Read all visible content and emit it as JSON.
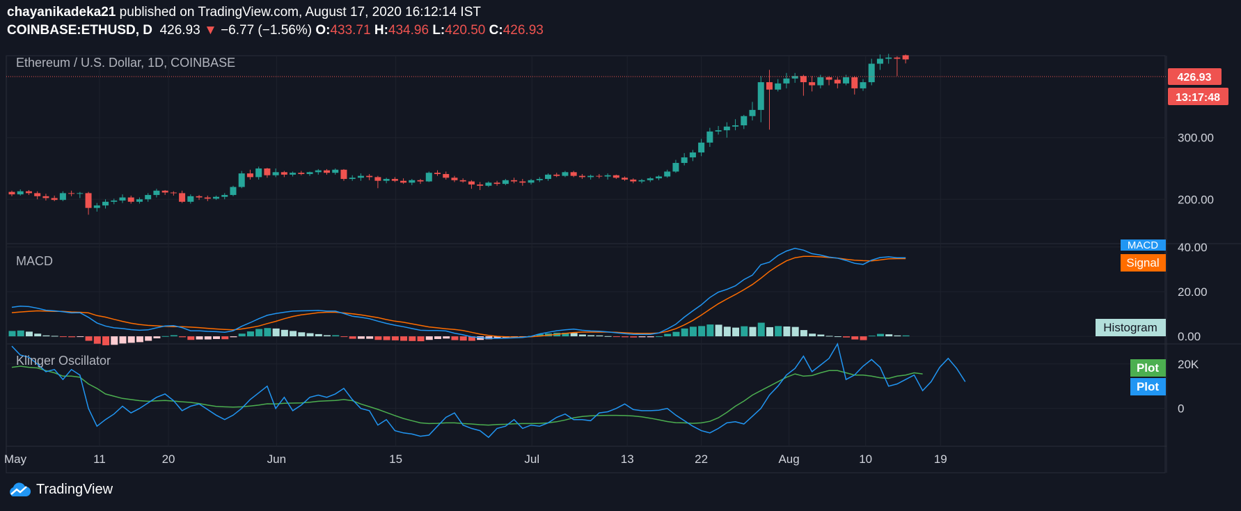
{
  "header": {
    "author": "chayanikadeka21",
    "published_text": "published on TradingView.com, August 17, 2020 16:12:14 IST",
    "symbol": "COINBASE:ETHUSD, D",
    "last": "426.93",
    "change": "−6.77 (−1.56%)",
    "o_label": "O:",
    "o": "433.71",
    "h_label": "H:",
    "h": "434.96",
    "l_label": "L:",
    "l": "420.50",
    "c_label": "C:",
    "c": "426.93"
  },
  "panes": {
    "main_title": "Ethereum / U.S. Dollar, 1D, COINBASE",
    "macd_title": "MACD",
    "klinger_title": "Klinger Oscillator"
  },
  "badges": {
    "price": "426.93",
    "countdown": "13:17:48",
    "macd": "MACD",
    "signal": "Signal",
    "histogram": "Histogram",
    "plot1": "Plot",
    "plot2": "Plot"
  },
  "footer": {
    "brand": "TradingView"
  },
  "colors": {
    "up": "#26a69a",
    "down": "#ef5350",
    "macd": "#2196f3",
    "signal": "#ff6d00",
    "klinger": "#2196f3",
    "klinger_signal": "#4caf50",
    "background": "#131722"
  },
  "chart_data": [
    {
      "type": "candlestick",
      "title": "Ethereum / U.S. Dollar, 1D, COINBASE",
      "x_tick_labels": [
        "May",
        "11",
        "20",
        "Jun",
        "15",
        "Jul",
        "13",
        "22",
        "Aug",
        "10",
        "19"
      ],
      "y_tick_labels": [
        "200.00",
        "300.00"
      ],
      "ylim": [
        128,
        433
      ],
      "last_price": 426.93,
      "ohlc": [
        [
          212,
          214,
          205,
          208
        ],
        [
          208,
          216,
          206,
          213
        ],
        [
          213,
          215,
          207,
          210
        ],
        [
          210,
          213,
          200,
          205
        ],
        [
          205,
          209,
          198,
          202
        ],
        [
          202,
          206,
          197,
          199
        ],
        [
          199,
          213,
          197,
          210
        ],
        [
          210,
          214,
          205,
          209
        ],
        [
          209,
          212,
          202,
          210
        ],
        [
          210,
          212,
          175,
          186
        ],
        [
          186,
          194,
          180,
          190
        ],
        [
          190,
          200,
          185,
          196
        ],
        [
          196,
          201,
          192,
          198
        ],
        [
          198,
          208,
          194,
          203
        ],
        [
          203,
          206,
          193,
          196
        ],
        [
          196,
          203,
          193,
          200
        ],
        [
          200,
          210,
          196,
          207
        ],
        [
          207,
          217,
          203,
          214
        ],
        [
          214,
          215,
          207,
          211
        ],
        [
          211,
          213,
          206,
          210
        ],
        [
          210,
          214,
          194,
          196
        ],
        [
          196,
          208,
          193,
          205
        ],
        [
          205,
          207,
          199,
          203
        ],
        [
          203,
          206,
          197,
          201
        ],
        [
          201,
          206,
          199,
          204
        ],
        [
          204,
          210,
          200,
          207
        ],
        [
          207,
          222,
          205,
          220
        ],
        [
          220,
          246,
          218,
          242
        ],
        [
          242,
          248,
          232,
          236
        ],
        [
          236,
          253,
          232,
          250
        ],
        [
          250,
          251,
          235,
          239
        ],
        [
          239,
          250,
          236,
          244
        ],
        [
          244,
          246,
          236,
          240
        ],
        [
          240,
          245,
          237,
          243
        ],
        [
          243,
          246,
          239,
          241
        ],
        [
          241,
          245,
          238,
          244
        ],
        [
          244,
          249,
          240,
          247
        ],
        [
          247,
          249,
          240,
          243
        ],
        [
          243,
          250,
          240,
          248
        ],
        [
          248,
          249,
          230,
          233
        ],
        [
          233,
          239,
          230,
          235
        ],
        [
          235,
          242,
          230,
          238
        ],
        [
          238,
          241,
          231,
          236
        ],
        [
          236,
          238,
          218,
          230
        ],
        [
          230,
          235,
          226,
          233
        ],
        [
          233,
          236,
          228,
          230
        ],
        [
          230,
          234,
          225,
          227
        ],
        [
          227,
          233,
          223,
          231
        ],
        [
          231,
          233,
          225,
          229
        ],
        [
          229,
          245,
          228,
          243
        ],
        [
          243,
          247,
          238,
          241
        ],
        [
          241,
          245,
          232,
          235
        ],
        [
          235,
          238,
          228,
          231
        ],
        [
          231,
          234,
          227,
          229
        ],
        [
          229,
          231,
          217,
          224
        ],
        [
          224,
          228,
          215,
          222
        ],
        [
          222,
          229,
          220,
          227
        ],
        [
          227,
          230,
          222,
          225
        ],
        [
          225,
          233,
          223,
          231
        ],
        [
          231,
          235,
          226,
          229
        ],
        [
          229,
          233,
          222,
          227
        ],
        [
          227,
          233,
          224,
          231
        ],
        [
          231,
          236,
          228,
          233
        ],
        [
          233,
          242,
          230,
          240
        ],
        [
          240,
          243,
          236,
          238
        ],
        [
          238,
          246,
          236,
          244
        ],
        [
          244,
          246,
          236,
          238
        ],
        [
          238,
          241,
          233,
          236
        ],
        [
          236,
          240,
          232,
          238
        ],
        [
          238,
          241,
          234,
          237
        ],
        [
          237,
          242,
          232,
          239
        ],
        [
          239,
          240,
          233,
          235
        ],
        [
          235,
          237,
          230,
          232
        ],
        [
          232,
          234,
          226,
          229
        ],
        [
          229,
          233,
          226,
          231
        ],
        [
          231,
          236,
          228,
          234
        ],
        [
          234,
          239,
          231,
          237
        ],
        [
          237,
          248,
          235,
          245
        ],
        [
          245,
          264,
          243,
          259
        ],
        [
          259,
          275,
          255,
          268
        ],
        [
          268,
          280,
          262,
          276
        ],
        [
          276,
          298,
          270,
          292
        ],
        [
          292,
          316,
          285,
          310
        ],
        [
          310,
          319,
          305,
          312
        ],
        [
          312,
          325,
          300,
          318
        ],
        [
          318,
          330,
          312,
          320
        ],
        [
          320,
          337,
          314,
          335
        ],
        [
          335,
          358,
          328,
          345
        ],
        [
          345,
          400,
          325,
          390
        ],
        [
          390,
          410,
          313,
          378
        ],
        [
          378,
          395,
          375,
          388
        ],
        [
          388,
          405,
          380,
          396
        ],
        [
          396,
          405,
          389,
          400
        ],
        [
          400,
          402,
          368,
          390
        ],
        [
          390,
          400,
          375,
          385
        ],
        [
          385,
          402,
          380,
          398
        ],
        [
          398,
          400,
          385,
          394
        ],
        [
          394,
          398,
          380,
          388
        ],
        [
          388,
          402,
          385,
          398
        ],
        [
          398,
          400,
          370,
          380
        ],
        [
          380,
          395,
          376,
          390
        ],
        [
          390,
          428,
          385,
          420
        ],
        [
          420,
          435,
          410,
          428
        ],
        [
          428,
          436,
          420,
          430
        ],
        [
          430,
          432,
          400,
          428
        ],
        [
          433.71,
          434.96,
          420.5,
          426.93
        ]
      ]
    },
    {
      "type": "line",
      "title": "MACD",
      "y_tick_labels": [
        "0.00",
        "20.00",
        "40.00"
      ],
      "ylim": [
        -3.4,
        41.5
      ],
      "series": [
        {
          "name": "MACD",
          "values": [
            13.0,
            13.5,
            13.3,
            12.6,
            11.7,
            11.4,
            11.0,
            10.5,
            10.6,
            8.5,
            6.0,
            4.6,
            3.8,
            3.5,
            3.0,
            2.7,
            2.9,
            3.8,
            4.6,
            4.8,
            3.9,
            2.5,
            2.5,
            2.2,
            2.1,
            1.8,
            2.5,
            4.5,
            6.1,
            7.9,
            9.4,
            10.2,
            10.8,
            11.3,
            11.4,
            11.5,
            11.6,
            11.3,
            11.3,
            10.2,
            9.0,
            8.5,
            7.9,
            6.8,
            5.8,
            5.0,
            4.3,
            3.5,
            2.7,
            2.6,
            2.6,
            2.4,
            1.4,
            0.7,
            -0.2,
            -0.6,
            -0.9,
            -0.9,
            -0.8,
            -0.7,
            -0.5,
            0.0,
            1.1,
            1.8,
            2.5,
            2.9,
            3.2,
            2.7,
            2.4,
            2.3,
            2.0,
            1.6,
            1.2,
            0.9,
            0.9,
            0.9,
            1.5,
            3.3,
            5.4,
            8.6,
            11.4,
            14.1,
            17.4,
            19.8,
            21.0,
            22.6,
            25.4,
            27.4,
            32.1,
            33.2,
            36.2,
            38.2,
            39.4,
            38.6,
            37.0,
            36.4,
            35.5,
            35.0,
            34.0,
            32.7,
            32.2,
            34.1,
            35.3,
            35.6,
            35.2,
            35.2
          ]
        },
        {
          "name": "Signal",
          "values": [
            10.6,
            10.9,
            11.2,
            11.4,
            11.3,
            11.2,
            11.2,
            10.9,
            10.8,
            10.5,
            9.3,
            8.6,
            7.6,
            6.7,
            5.9,
            5.3,
            4.9,
            4.7,
            4.5,
            4.3,
            4.3,
            4.1,
            3.9,
            3.6,
            3.3,
            3.1,
            2.9,
            3.3,
            3.9,
            4.6,
            5.7,
            6.7,
            7.9,
            8.9,
            9.6,
            10.1,
            10.6,
            10.8,
            10.8,
            10.5,
            10.1,
            9.6,
            9.0,
            8.4,
            7.5,
            6.8,
            6.3,
            5.6,
            4.9,
            4.2,
            3.8,
            3.4,
            3.1,
            2.6,
            1.8,
            1.0,
            0.4,
            0.0,
            -0.2,
            -0.3,
            -0.3,
            -0.2,
            0.1,
            0.5,
            0.9,
            1.3,
            1.7,
            1.9,
            1.9,
            1.9,
            1.9,
            1.8,
            1.6,
            1.4,
            1.3,
            1.3,
            1.5,
            2.2,
            3.4,
            5.1,
            7.1,
            9.5,
            12.1,
            14.6,
            16.7,
            18.7,
            20.9,
            23.2,
            26.0,
            29.1,
            31.6,
            33.8,
            35.2,
            35.8,
            35.8,
            35.6,
            35.3,
            35.0,
            34.5,
            34.1,
            33.9,
            33.8,
            34.2,
            34.7,
            34.8,
            34.8
          ]
        }
      ],
      "histogram": [
        2.4,
        2.6,
        2.1,
        1.2,
        0.4,
        0.2,
        -0.2,
        -0.4,
        -0.2,
        -2.0,
        -3.3,
        -4.0,
        -3.8,
        -3.2,
        -2.9,
        -2.6,
        -2.0,
        -0.9,
        0.1,
        0.5,
        -0.4,
        -1.6,
        -1.4,
        -1.4,
        -1.2,
        -1.3,
        -0.4,
        1.2,
        2.2,
        3.3,
        3.7,
        3.5,
        2.9,
        2.4,
        1.8,
        1.4,
        1.0,
        0.5,
        0.5,
        -0.3,
        -1.1,
        -1.1,
        -1.1,
        -1.6,
        -1.7,
        -1.8,
        -2.0,
        -2.1,
        -2.2,
        -1.6,
        -1.2,
        -1.0,
        -1.7,
        -1.9,
        -2.0,
        -1.6,
        -1.3,
        -0.9,
        -0.6,
        -0.4,
        -0.2,
        0.2,
        1.0,
        1.3,
        1.6,
        1.6,
        1.5,
        0.8,
        0.5,
        0.4,
        0.1,
        -0.2,
        -0.4,
        -0.5,
        -0.4,
        -0.4,
        0.0,
        1.1,
        2.0,
        3.5,
        4.3,
        4.6,
        5.3,
        5.2,
        4.3,
        3.9,
        4.5,
        4.2,
        6.1,
        4.1,
        4.6,
        4.4,
        4.2,
        2.8,
        1.2,
        0.8,
        0.2,
        0.0,
        -0.5,
        -1.4,
        -1.7,
        0.3,
        1.1,
        0.9,
        0.4,
        0.4
      ]
    },
    {
      "type": "line",
      "title": "Klinger Oscillator",
      "y_tick_labels": [
        "0",
        "20K"
      ],
      "ylim": [
        -17000,
        29000
      ],
      "series": [
        {
          "name": "Plot",
          "values": [
            28000,
            24000,
            23000,
            20000,
            16500,
            17500,
            13000,
            17500,
            15000,
            0,
            -8000,
            -5000,
            -2500,
            1000,
            -2000,
            0,
            2500,
            5000,
            6500,
            3500,
            -1000,
            1000,
            2000,
            -500,
            -3000,
            -5000,
            -3000,
            0,
            4000,
            7000,
            10000,
            0,
            5000,
            -1000,
            1500,
            5000,
            6000,
            5000,
            6500,
            9000,
            4000,
            0,
            -1000,
            -7500,
            -5000,
            -10000,
            -11000,
            -11500,
            -12500,
            -12000,
            -8000,
            -4000,
            -2000,
            -7500,
            -9000,
            -10000,
            -13000,
            -9000,
            -8000,
            -5000,
            -9000,
            -7500,
            -8000,
            -6500,
            -4000,
            -2500,
            -5000,
            -5000,
            -5500,
            -2000,
            -1500,
            0,
            2000,
            -500,
            -1000,
            -1000,
            -800,
            0,
            -3000,
            -5500,
            -8000,
            -10000,
            -11000,
            -9000,
            -6500,
            -6000,
            -7000,
            -3500,
            0,
            6000,
            10000,
            15000,
            18000,
            23500,
            16500,
            19500,
            22500,
            29000,
            13000,
            15000,
            19000,
            22000,
            18500,
            10000,
            11000,
            13000,
            15000,
            8000,
            12000,
            18500,
            22500,
            18000,
            12000
          ]
        },
        {
          "name": "Plot",
          "values": [
            18500,
            19000,
            18500,
            18200,
            17000,
            16000,
            14500,
            14500,
            14000,
            11000,
            9000,
            6500,
            5500,
            4500,
            4000,
            3500,
            3200,
            3400,
            3600,
            3300,
            3000,
            2700,
            2200,
            1500,
            900,
            700,
            600,
            700,
            1100,
            1500,
            2100,
            2000,
            2300,
            2400,
            2500,
            2800,
            3200,
            3400,
            3600,
            4000,
            3500,
            2000,
            800,
            -400,
            -1800,
            -3200,
            -4500,
            -5500,
            -6500,
            -6800,
            -6700,
            -6500,
            -6500,
            -6800,
            -7000,
            -7300,
            -7500,
            -7200,
            -7100,
            -6900,
            -6800,
            -6800,
            -6700,
            -6500,
            -6000,
            -5200,
            -4200,
            -3600,
            -3300,
            -3200,
            -3100,
            -3100,
            -3200,
            -3400,
            -3800,
            -4400,
            -5100,
            -5900,
            -6400,
            -6500,
            -6700,
            -6500,
            -5800,
            -4200,
            -1800,
            1000,
            3300,
            6000,
            8000,
            10000,
            12000,
            14000,
            15500,
            14500,
            14800,
            16000,
            17000,
            17000,
            16000,
            15000,
            15000,
            14500,
            13800,
            13500,
            14500,
            15000,
            16000,
            15500
          ]
        }
      ]
    }
  ]
}
